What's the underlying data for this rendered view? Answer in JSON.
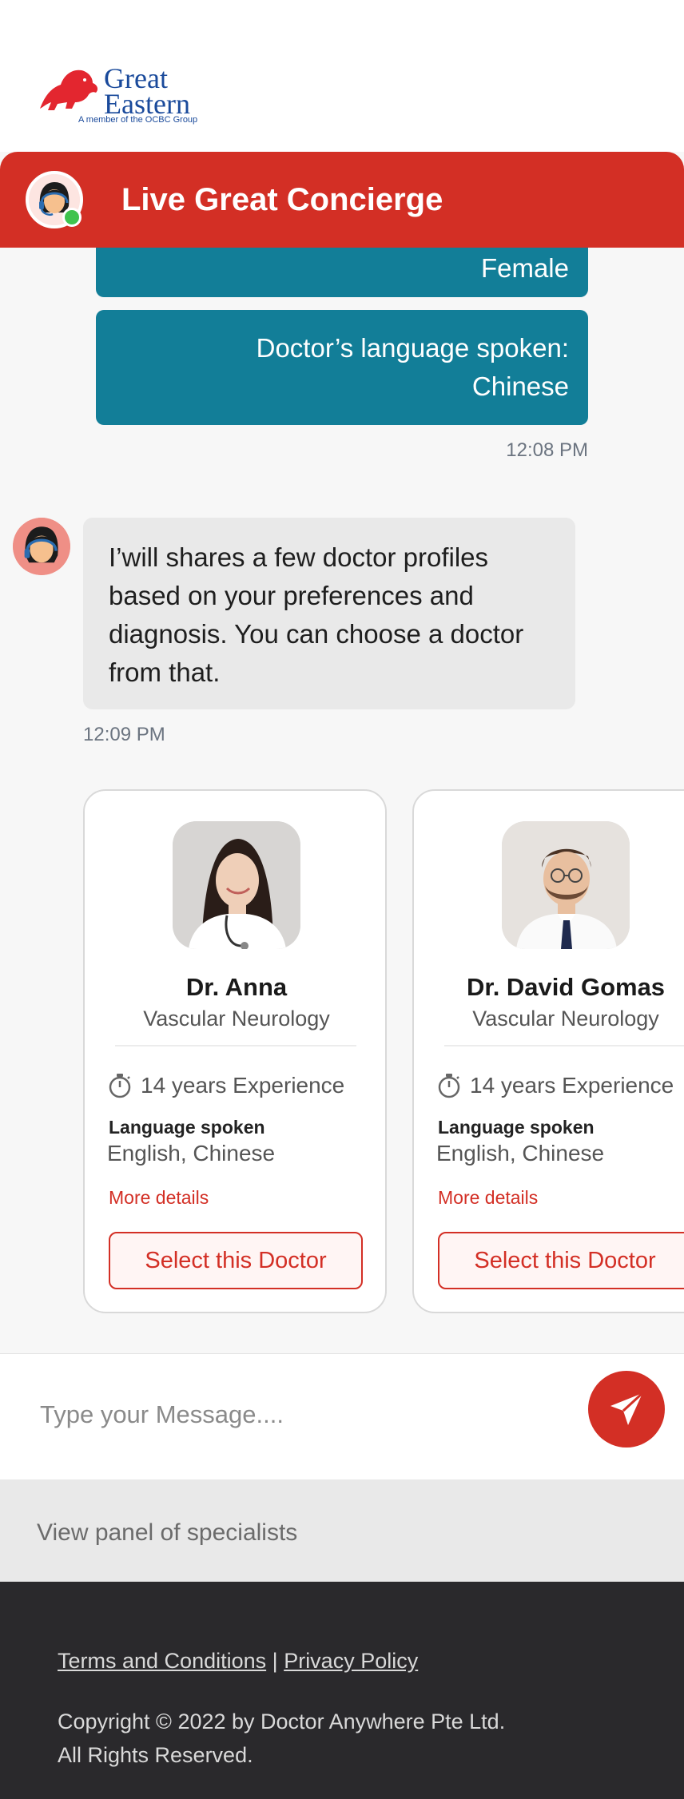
{
  "brand": {
    "logo_line1": "Great",
    "logo_line2": "Eastern",
    "logo_tagline": "A member of the OCBC Group",
    "primary_color": "#d32f25",
    "teal_color": "#127e98"
  },
  "header": {
    "title": "Live Great Concierge"
  },
  "chat": {
    "user_messages": [
      {
        "text": "Female"
      },
      {
        "text_line1": "Doctor’s language spoken:",
        "text_line2": "Chinese"
      }
    ],
    "user_time": "12:08 PM",
    "agent_message": "I’will shares a few doctor profiles based on your preferences and diagnosis. You can choose a doctor from that.",
    "agent_time": "12:09 PM"
  },
  "doctors": [
    {
      "name": "Dr. Anna",
      "specialty": "Vascular Neurology",
      "experience": "14 years Experience",
      "language_label": "Language spoken",
      "languages": "English, Chinese",
      "more_label": "More details",
      "select_label": "Select this Doctor"
    },
    {
      "name": "Dr. David Gomas",
      "specialty": "Vascular Neurology",
      "experience": "14 years Experience",
      "language_label": "Language spoken",
      "languages": "English, Chinese",
      "more_label": "More details",
      "select_label": "Select this Doctor"
    }
  ],
  "composer": {
    "placeholder": "Type your Message...."
  },
  "panel": {
    "link_label": "View panel of specialists"
  },
  "footer": {
    "terms_label": "Terms and Conditions",
    "separator": "|",
    "privacy_label": "Privacy Policy",
    "copyright_line1": "Copyright © 2022 by Doctor Anywhere Pte Ltd.",
    "copyright_line2": "All Rights Reserved."
  }
}
